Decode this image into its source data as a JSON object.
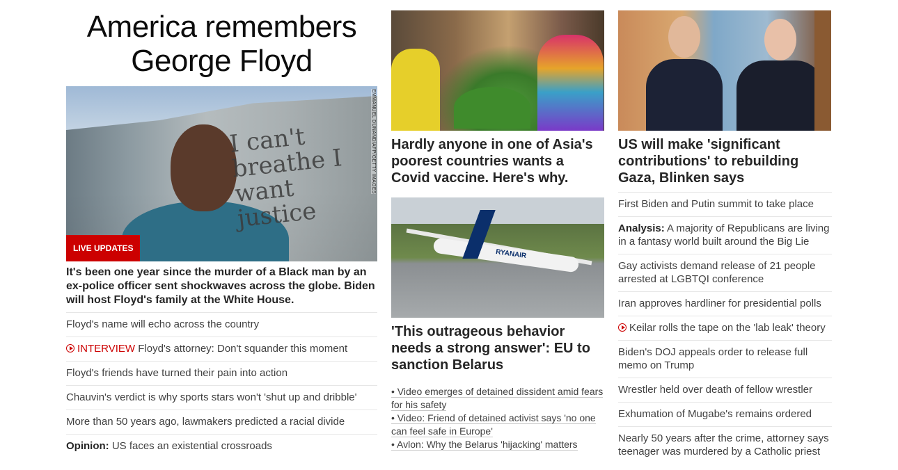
{
  "hero": {
    "title": "America remembers George Floyd",
    "image_credit": "EMMANUEL DUNAND/AFP/GETTY IMAGES",
    "graffiti": "I can't breathe I want justice",
    "badge": "LIVE UPDATES",
    "description": "It's been one year since the murder of a Black man by an ex-police officer sent shockwaves across the globe. Biden will host Floyd's family at the White House."
  },
  "col1_links": [
    {
      "text": "Floyd's name will echo across the country"
    },
    {
      "prefix": "INTERVIEW",
      "text": "Floyd's attorney: Don't squander this moment",
      "icon": "play-icon"
    },
    {
      "text": "Floyd's friends have turned their pain into action"
    },
    {
      "text": "Chauvin's verdict is why sports stars won't 'shut up and dribble'"
    },
    {
      "text": "More than 50 years ago, lawmakers predicted a racial divide"
    },
    {
      "label": "Opinion:",
      "text": "US faces an existential crossroads"
    }
  ],
  "col2": {
    "story1_title": "Hardly anyone in one of Asia's poorest countries wants a Covid vaccine. Here's why.",
    "story2_plane_label": "RYANAIR",
    "story2_title": "'This outrageous behavior needs a strong answer': EU to sanction Belarus",
    "bullets": [
      "• Video emerges of detained dissident amid fears for his safety",
      "• Video: Friend of detained activist says 'no one can feel safe in Europe'",
      "• Avlon: Why the Belarus 'hijacking' matters"
    ]
  },
  "col3": {
    "story_title": "US will make 'significant contributions' to rebuilding Gaza, Blinken says",
    "links": [
      {
        "text": "First Biden and Putin summit to take place"
      },
      {
        "label": "Analysis:",
        "text": "A majority of Republicans are living in a fantasy world built around the Big Lie"
      },
      {
        "text": "Gay activists demand release of 21 people arrested at LGBTQI conference"
      },
      {
        "text": "Iran approves hardliner for presidential polls"
      },
      {
        "text": "Keilar rolls the tape on the 'lab leak' theory",
        "icon": "play-icon"
      },
      {
        "text": "Biden's DOJ appeals order to release full memo on Trump"
      },
      {
        "text": "Wrestler held over death of fellow wrestler"
      },
      {
        "text": "Exhumation of Mugabe's remains ordered"
      },
      {
        "text": "Nearly 50 years after the crime, attorney says teenager was murdered by a Catholic priest"
      }
    ]
  },
  "colors": {
    "accent_red": "#cc0000",
    "text": "#262626",
    "divider": "#e6e6e6"
  }
}
